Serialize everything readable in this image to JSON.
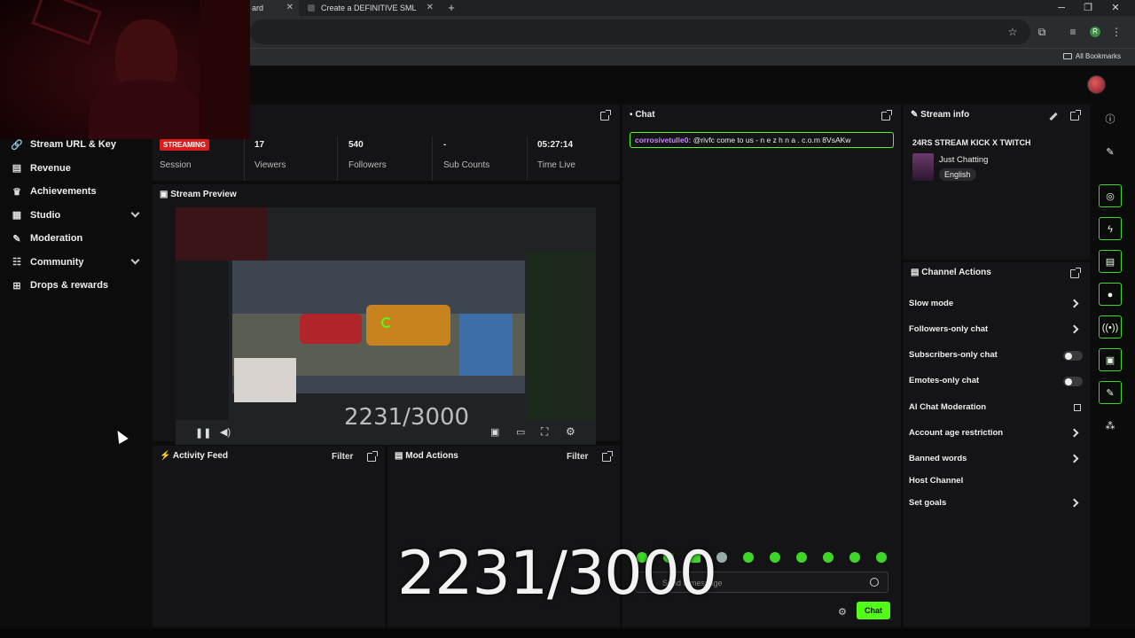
{
  "browser": {
    "tabs": [
      {
        "title": "ard"
      },
      {
        "title": "Create a DEFINITIVE SML CHAR"
      }
    ],
    "new_tab_icon": "plus-icon",
    "bookmarks_label": "All Bookmarks",
    "profile_initial": "R"
  },
  "nav": {
    "items": [
      {
        "label": "Stream URL & Key",
        "icon": "link-icon"
      },
      {
        "label": "Revenue",
        "icon": "money-icon"
      },
      {
        "label": "Achievements",
        "icon": "trophy-icon"
      },
      {
        "label": "Studio",
        "icon": "studio-icon"
      },
      {
        "label": "Moderation",
        "icon": "wrench-icon"
      },
      {
        "label": "Community",
        "icon": "community-icon"
      },
      {
        "label": "Drops & rewards",
        "icon": "gift-icon"
      }
    ]
  },
  "stats": {
    "status_badge": "STREAMING",
    "session_label": "Session",
    "viewers_value": "17",
    "viewers_label": "Viewers",
    "followers_value": "540",
    "followers_label": "Followers",
    "subs_value": "-",
    "subs_label": "Sub Counts",
    "time_value": "05:27:14",
    "time_label": "Time Live"
  },
  "preview": {
    "title": "Stream Preview",
    "overlay_counter": "2231/3000"
  },
  "activity": {
    "title": "Activity Feed",
    "filter": "Filter"
  },
  "mod_actions": {
    "title": "Mod Actions",
    "filter": "Filter"
  },
  "chat": {
    "title": "Chat",
    "message_user": "corrosivetulle0:",
    "message_text": "@rivfc come to us - n e z h n a . c.o.m 8VsAKw",
    "input_placeholder": "Send a message",
    "send_label": "Chat"
  },
  "overlay_counter": "2231/3000",
  "stream_info": {
    "title": "Stream info",
    "stream_title": "24RS STREAM KICK X TWITCH",
    "category": "Just Chatting",
    "language": "English"
  },
  "channel_actions": {
    "title": "Channel Actions",
    "items": [
      {
        "label": "Slow mode",
        "control": "arrow"
      },
      {
        "label": "Followers-only chat",
        "control": "arrow"
      },
      {
        "label": "Subscribers-only chat",
        "control": "toggle",
        "state": "off"
      },
      {
        "label": "Emotes-only chat",
        "control": "toggle",
        "state": "off"
      },
      {
        "label": "AI Chat Moderation",
        "control": "external"
      },
      {
        "label": "Account age restriction",
        "control": "arrow"
      },
      {
        "label": "Banned words",
        "control": "arrow"
      },
      {
        "label": "Host Channel",
        "control": "none"
      },
      {
        "label": "Set goals",
        "control": "arrow"
      }
    ]
  },
  "rail": {
    "icons": [
      "info-icon",
      "pencil-icon",
      "screenshot-icon",
      "lightning-icon",
      "note-icon",
      "chat-bubble-icon",
      "broadcast-icon",
      "camera-switch-icon",
      "wrench-icon",
      "nodes-icon"
    ]
  },
  "colors": {
    "accent": "#53fc18",
    "live_badge": "#d91c1c",
    "chat_username": "#c887ff",
    "panel_bg": "#141416"
  }
}
